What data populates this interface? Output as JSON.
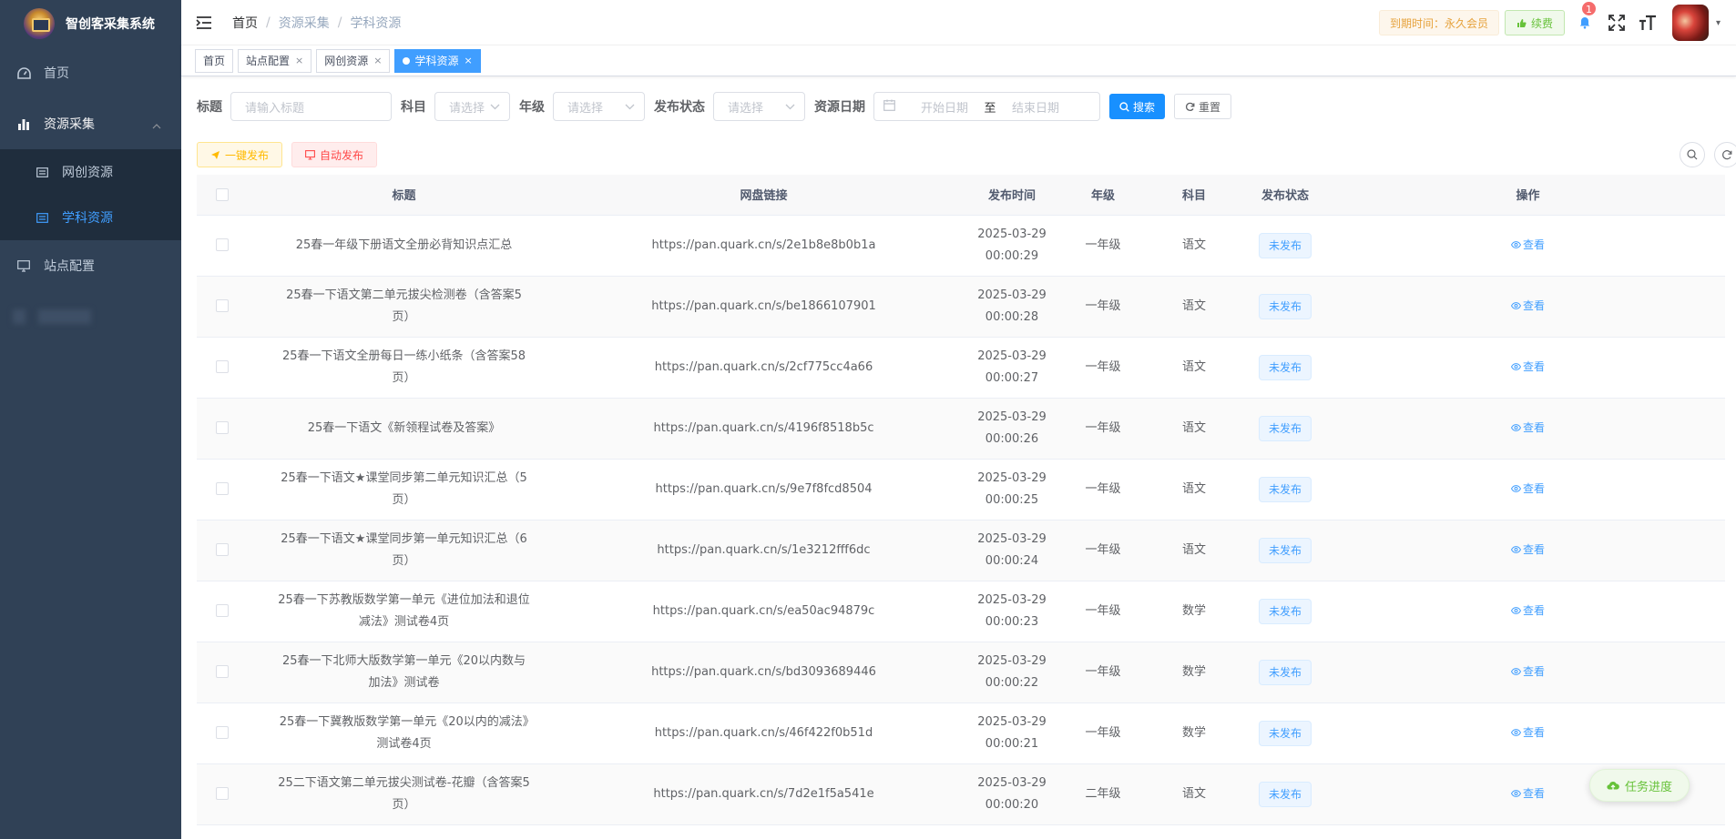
{
  "app": {
    "title": "智创客采集系统"
  },
  "sidebar": {
    "items": [
      {
        "label": "首页",
        "icon": "dashboard-icon"
      },
      {
        "label": "资源采集",
        "icon": "chart-icon"
      },
      {
        "label": "站点配置",
        "icon": "monitor-icon"
      }
    ],
    "subitems": [
      {
        "label": "网创资源",
        "icon": "list-icon"
      },
      {
        "label": "学科资源",
        "icon": "list-icon"
      }
    ]
  },
  "breadcrumb": [
    "首页",
    "资源采集",
    "学科资源"
  ],
  "header": {
    "vip_text": "到期时间：永久会员",
    "renew_label": "续费",
    "notification_count": "1"
  },
  "tabs": [
    {
      "label": "首页"
    },
    {
      "label": "站点配置"
    },
    {
      "label": "网创资源"
    },
    {
      "label": "学科资源"
    }
  ],
  "filters": {
    "title_label": "标题",
    "title_placeholder": "请输入标题",
    "subject_label": "科目",
    "subject_placeholder": "请选择",
    "grade_label": "年级",
    "grade_placeholder": "请选择",
    "status_label": "发布状态",
    "status_placeholder": "请选择",
    "date_label": "资源日期",
    "start_placeholder": "开始日期",
    "date_sep": "至",
    "end_placeholder": "结束日期",
    "search_label": "搜索",
    "reset_label": "重置"
  },
  "actions": {
    "publish_all": "一键发布",
    "auto_publish": "自动发布"
  },
  "table": {
    "headers": [
      "标题",
      "网盘链接",
      "发布时间",
      "年级",
      "科目",
      "发布状态",
      "操作"
    ],
    "view_label": "查看",
    "rows": [
      {
        "title": "25春一年级下册语文全册必背知识点汇总",
        "link": "https://pan.quark.cn/s/2e1b8e8b0b1a",
        "date": "2025-03-29",
        "time": "00:00:29",
        "grade": "一年级",
        "subject": "语文",
        "status": "未发布"
      },
      {
        "title": "25春一下语文第二单元拔尖检测卷（含答案5页）",
        "link": "https://pan.quark.cn/s/be1866107901",
        "date": "2025-03-29",
        "time": "00:00:28",
        "grade": "一年级",
        "subject": "语文",
        "status": "未发布"
      },
      {
        "title": "25春一下语文全册每日一练小纸条（含答案58页）",
        "link": "https://pan.quark.cn/s/2cf775cc4a66",
        "date": "2025-03-29",
        "time": "00:00:27",
        "grade": "一年级",
        "subject": "语文",
        "status": "未发布"
      },
      {
        "title": "25春一下语文《新领程试卷及答案》",
        "link": "https://pan.quark.cn/s/4196f8518b5c",
        "date": "2025-03-29",
        "time": "00:00:26",
        "grade": "一年级",
        "subject": "语文",
        "status": "未发布"
      },
      {
        "title": "25春一下语文★课堂同步第二单元知识汇总（5页）",
        "link": "https://pan.quark.cn/s/9e7f8fcd8504",
        "date": "2025-03-29",
        "time": "00:00:25",
        "grade": "一年级",
        "subject": "语文",
        "status": "未发布"
      },
      {
        "title": "25春一下语文★课堂同步第一单元知识汇总（6页）",
        "link": "https://pan.quark.cn/s/1e3212fff6dc",
        "date": "2025-03-29",
        "time": "00:00:24",
        "grade": "一年级",
        "subject": "语文",
        "status": "未发布"
      },
      {
        "title": "25春一下苏教版数学第一单元《进位加法和退位减法》测试卷4页",
        "link": "https://pan.quark.cn/s/ea50ac94879c",
        "date": "2025-03-29",
        "time": "00:00:23",
        "grade": "一年级",
        "subject": "数学",
        "status": "未发布"
      },
      {
        "title": "25春一下北师大版数学第一单元《20以内数与加法》测试卷",
        "link": "https://pan.quark.cn/s/bd3093689446",
        "date": "2025-03-29",
        "time": "00:00:22",
        "grade": "一年级",
        "subject": "数学",
        "status": "未发布"
      },
      {
        "title": "25春一下冀教版数学第一单元《20以内的减法》测试卷4页",
        "link": "https://pan.quark.cn/s/46f422f0b51d",
        "date": "2025-03-29",
        "time": "00:00:21",
        "grade": "一年级",
        "subject": "数学",
        "status": "未发布"
      },
      {
        "title": "25二下语文第二单元拔尖测试卷-花瓣（含答案5页）",
        "link": "https://pan.quark.cn/s/7d2e1f5a541e",
        "date": "2025-03-29",
        "time": "00:00:20",
        "grade": "二年级",
        "subject": "语文",
        "status": "未发布"
      }
    ]
  },
  "task_progress_label": "任务进度",
  "colors": {
    "sidebar_bg": "#304156",
    "submenu_bg": "#1f2d3d",
    "accent": "#409eff",
    "primary_button": "#1890ff",
    "success": "#67c23a",
    "warning": "#e6a23c",
    "danger": "#ff4949"
  }
}
